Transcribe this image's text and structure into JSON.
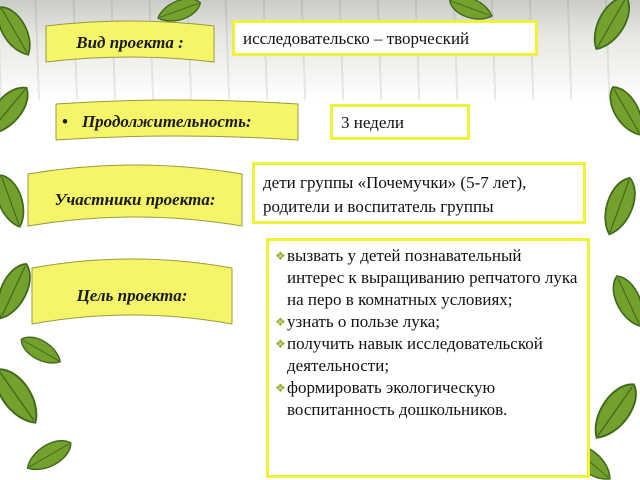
{
  "rows": [
    {
      "label": "Вид проекта :",
      "value": "исследовательско – творческий"
    },
    {
      "label": "Продолжительность:",
      "value": "3 недели"
    },
    {
      "label": "Участники проекта:",
      "value": "дети группы «Почемучки» (5-7 лет), родители и воспитатель группы"
    },
    {
      "label": "Цель проекта:",
      "items": [
        "вызвать у детей познавательный интерес к выращиванию репчатого лука на перо в комнатных условиях;",
        "узнать о пользе лука;",
        "получить навык исследовательской деятельности;",
        "формировать экологическую воспитанность дошкольников."
      ]
    }
  ],
  "bullet_glyph": "❖",
  "colors": {
    "banner": "#f5f56a",
    "border": "#f0f23a",
    "leaf": "#6f9a2c",
    "leaf_dark": "#3e6a1a"
  }
}
